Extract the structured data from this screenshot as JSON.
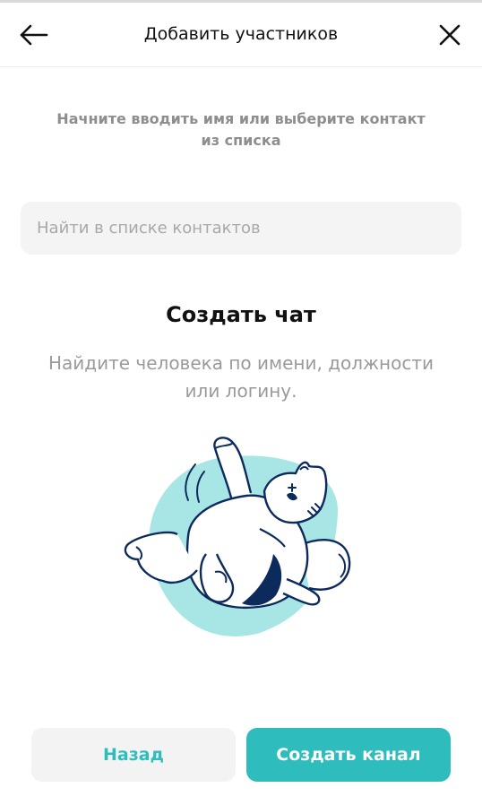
{
  "header": {
    "title": "Добавить участников",
    "back_icon": "arrow-left-icon",
    "close_icon": "close-icon"
  },
  "hint": {
    "line1": "Начните вводить имя или выберите контакт",
    "line2": "из списка"
  },
  "search": {
    "placeholder": "Найти в списке контактов",
    "value": ""
  },
  "empty_state": {
    "title": "Создать чат",
    "desc_line1": "Найдите человека по имени, должности",
    "desc_line2": "или логину.",
    "illustration": "cat-illustration"
  },
  "footer": {
    "back_label": "Назад",
    "create_label": "Создать канал"
  },
  "colors": {
    "accent": "#2fbcbc",
    "illustration_bg": "#a8e6e6",
    "ink": "#0d2a5c"
  }
}
